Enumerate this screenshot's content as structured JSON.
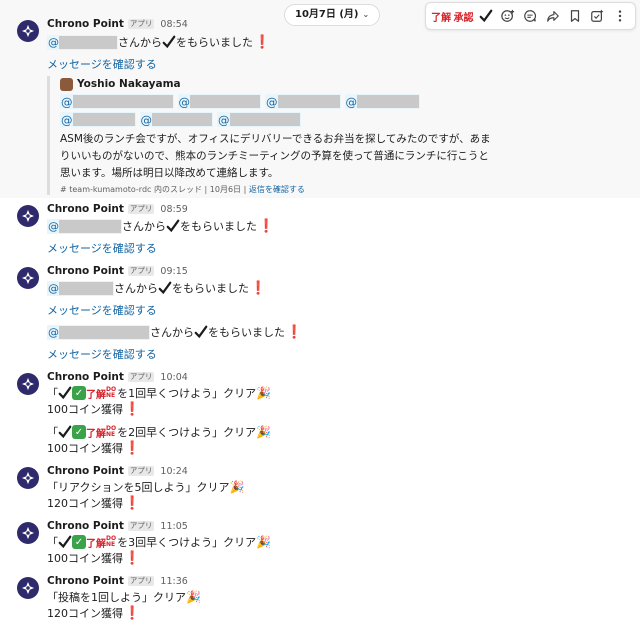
{
  "date_divider": {
    "label": "10月7日 (月)",
    "chevron": "chevron-down-icon"
  },
  "toolbar": {
    "items": [
      "了解",
      "承認",
      "✔",
      "add-reaction-icon",
      "reply-in-thread-icon",
      "forward-icon",
      "bookmark-icon",
      "create-task-icon",
      "more-options-icon"
    ],
    "reaction_1": "了解",
    "reaction_2": "承認"
  },
  "common": {
    "sender": "Chrono Point",
    "app_badge": "アプリ",
    "view_link": "メッセージを確認する",
    "mention_prefix": "@",
    "got_suffix": "さんから",
    "got_tail": "をもらいました",
    "exclamation": "❗"
  },
  "messages": [
    {
      "time": "08:54"
    },
    {
      "time": "08:59"
    },
    {
      "time": "09:15"
    },
    {
      "time": "10:04",
      "quest1": "を1回早くつけよう」クリア",
      "quest2": "を2回早くつけよう」クリア",
      "coins": "100コイン獲得"
    },
    {
      "time": "10:24",
      "quest": "「リアクションを5回しよう」クリア",
      "coins": "120コイン獲得"
    },
    {
      "time": "11:05",
      "quest": "を3回早くつけよう」クリア",
      "coins": "100コイン獲得"
    },
    {
      "time": "11:36",
      "quest": "「投稿を1回しよう」クリア",
      "coins": "120コイン獲得"
    }
  ],
  "quote": {
    "author": "Yoshio Nakayama",
    "body": "ASM後のランチ会ですが、オフィスにデリバリーできるお弁当を探してみたのですが、あまりいいものがないので、熊本のランチミーティングの予算を使って普通にランチに行こうと思います。場所は明日以降改めて連絡します。",
    "channel": "# team-kumamoto-rdc 内のスレッド",
    "date": "10月6日",
    "sep": "|",
    "reply_link": "返信を確認する"
  },
  "quest_open_bracket": "「",
  "done_label": [
    "DO",
    "NE"
  ],
  "ok_mark": "✓"
}
